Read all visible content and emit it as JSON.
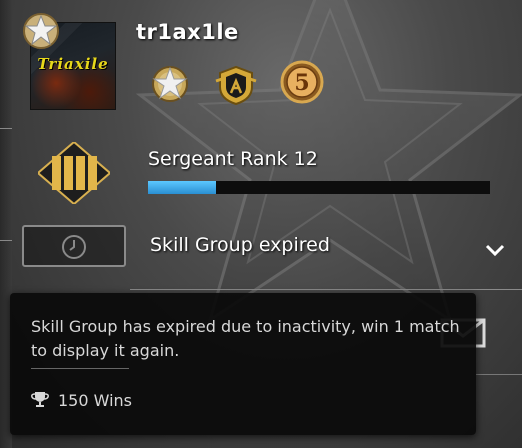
{
  "profile": {
    "username": "tr1ax1le",
    "avatar_text": "Triaxile"
  },
  "badges": [
    {
      "name": "service-medal-star-icon"
    },
    {
      "name": "crest-coin-icon"
    },
    {
      "name": "five-year-coin-icon",
      "label": "5"
    }
  ],
  "rank": {
    "title": "Sergeant Rank 12",
    "progress": 0.2
  },
  "skill_group": {
    "label": "Skill Group expired"
  },
  "tooltip": {
    "message": "Skill Group has expired due to inactivity, win 1 match to display it again.",
    "wins": "150 Wins"
  },
  "colors": {
    "xp_fill": "#3aaaf0",
    "gold": "#e0b030"
  }
}
